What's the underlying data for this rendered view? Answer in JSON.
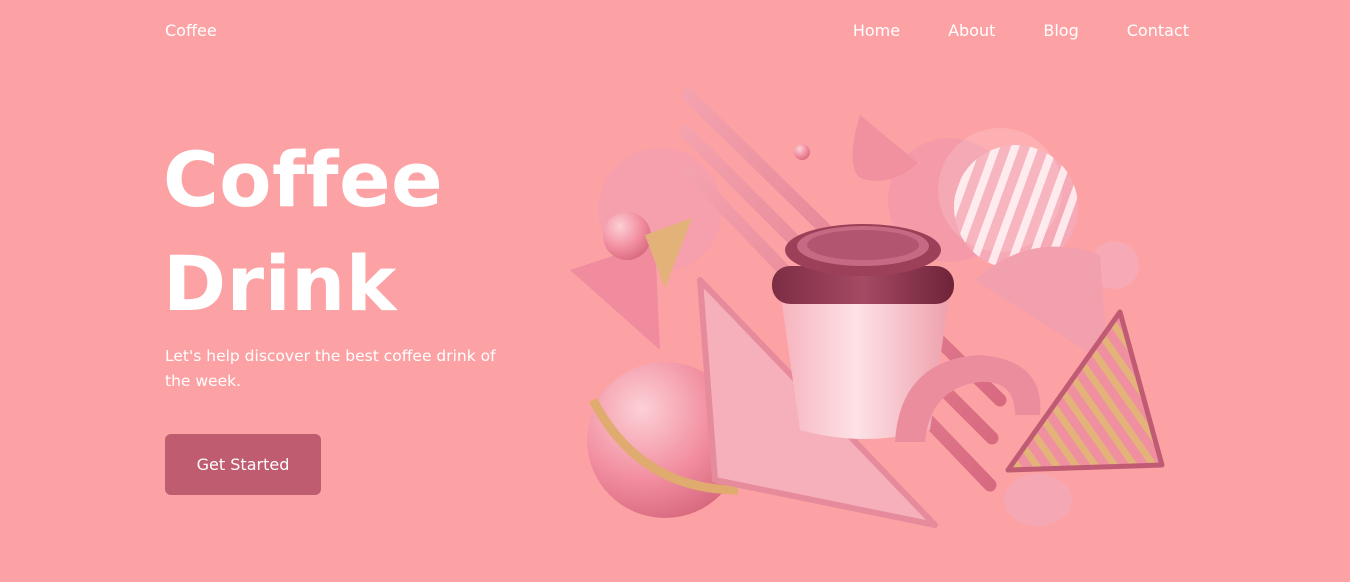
{
  "nav": {
    "logo": "Coffee",
    "links": [
      "Home",
      "About",
      "Blog",
      "Contact"
    ]
  },
  "hero": {
    "title_line1": "Coffee",
    "title_line2": "Drink",
    "subtitle": "Let's help discover the best coffee drink of the week.",
    "cta_label": "Get Started"
  },
  "colors": {
    "background": "#fda2a4",
    "button": "#c05c6f",
    "text": "#ffffff",
    "cup_lid": "#8e3b52"
  },
  "illustration": "coffee-cup-3d-shapes"
}
